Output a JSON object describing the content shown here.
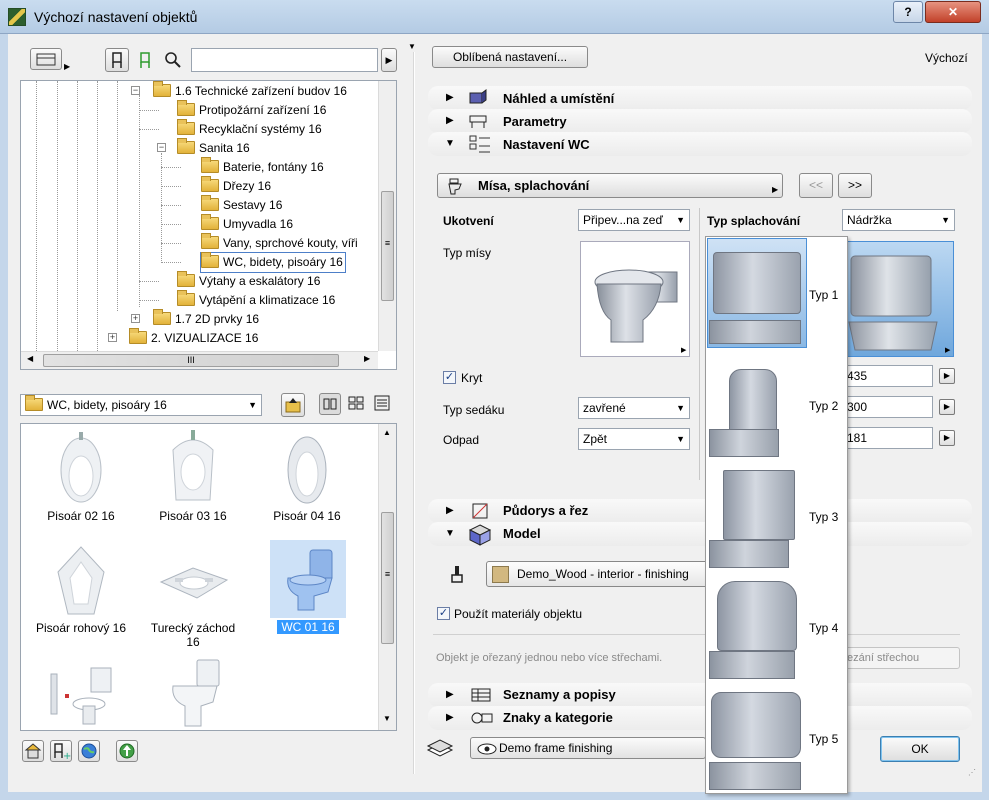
{
  "window": {
    "title": "Výchozí nastavení objektů",
    "help": "?",
    "close": "✕"
  },
  "left": {
    "tree": [
      {
        "label": "1.6 Technické zařízení budov 16",
        "expander": "−"
      },
      {
        "label": "Protipožární zařízení 16"
      },
      {
        "label": "Recyklační systémy 16"
      },
      {
        "label": "Sanita 16",
        "expander": "−"
      },
      {
        "label": "Baterie, fontány 16"
      },
      {
        "label": "Dřezy 16"
      },
      {
        "label": "Sestavy 16"
      },
      {
        "label": "Umyvadla 16"
      },
      {
        "label": "Vany, sprchové kouty, víři"
      },
      {
        "label": "WC, bidety, pisoáry 16"
      },
      {
        "label": "Výtahy a eskalátory 16"
      },
      {
        "label": "Vytápění a klimatizace 16"
      },
      {
        "label": "1.7 2D prvky 16",
        "expander": "+"
      },
      {
        "label": "2. VIZUALIZACE 16",
        "expander": "+"
      }
    ],
    "hscroll_grip": "III",
    "folder_combo": "WC, bidety, pisoáry 16",
    "items": [
      {
        "label": "Pisoár 02 16"
      },
      {
        "label": "Pisoár 03 16"
      },
      {
        "label": "Pisoár 04 16"
      },
      {
        "label": "Pisoár rohový 16"
      },
      {
        "label": "Turecký záchod 16"
      },
      {
        "label": "WC 01 16",
        "selected": true
      },
      {
        "label": ""
      },
      {
        "label": ""
      }
    ],
    "vscroll_grip": "≡"
  },
  "right": {
    "favorites_button": "Oblíbená nastavení...",
    "default_label": "Výchozí",
    "sections": {
      "preview": "Náhled a umístění",
      "parameters": "Parametry",
      "wc_settings": "Nastavení WC",
      "floorplan": "Půdorys a řez",
      "model": "Model",
      "lists": "Seznamy a popisy",
      "tags": "Znaky a kategorie"
    },
    "page_selector": "Mísa, splachování",
    "prev": "<<",
    "next": ">>",
    "ukotveni_label": "Ukotvení",
    "ukotveni_value": "Připev...na zeď",
    "typ_splachovani_label": "Typ splachování",
    "typ_splachovani_value": "Nádržka",
    "typ_misy_label": "Typ mísy",
    "kryt_label": "Kryt",
    "typ_sedaku_label": "Typ sedáku",
    "typ_sedaku_value": "zavřené",
    "odpad_label": "Odpad",
    "odpad_value": "Zpět",
    "num_values": [
      "435",
      "300",
      "181"
    ],
    "material_value": "Demo_Wood - interior - finishing",
    "use_materials_label": "Použít materiály objektu",
    "roof_note": "Objekt je ořezaný jednou nebo více střechami.",
    "roof_button": "ezání střechou",
    "bottom_combo": "Demo frame finishing",
    "ok": "OK"
  },
  "popup": {
    "items": [
      "Typ 1",
      "Typ 2",
      "Typ 3",
      "Typ 4",
      "Typ 5"
    ]
  },
  "colors": {
    "selection": "#cde1f7",
    "selection_text": "#3399ff",
    "titlebar": "#b9cfe7"
  }
}
